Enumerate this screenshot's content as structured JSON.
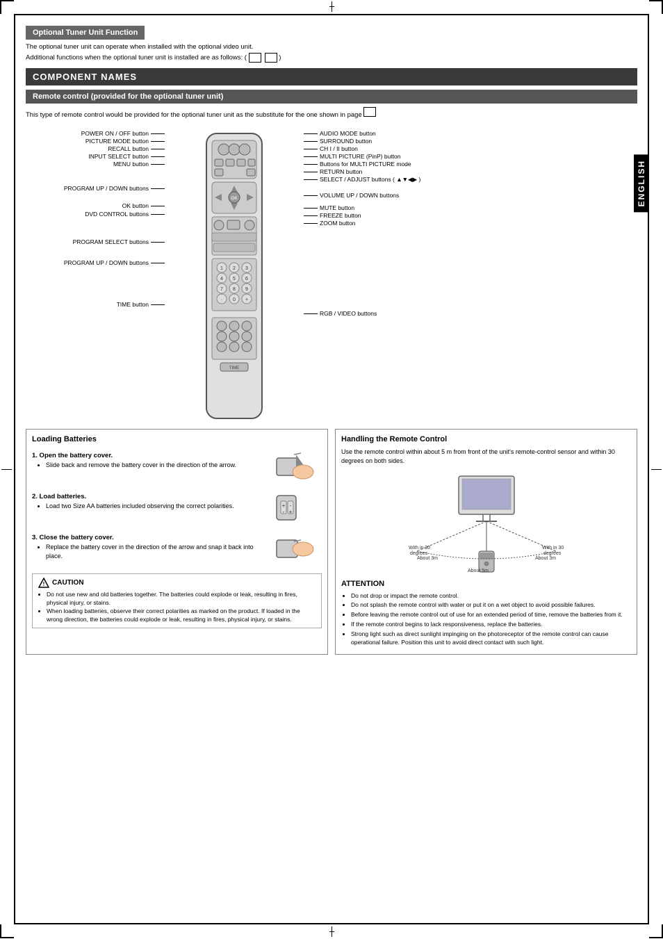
{
  "page": {
    "english_tab": "ENGLISH",
    "optional_header": "Optional Tuner Unit Function",
    "optional_desc1": "The optional tuner unit can operate when installed with the optional video unit.",
    "optional_desc2": "Additional functions when the optional tuner unit is installed are as follows: (",
    "component_names": "COMPONENT NAMES",
    "remote_section_title": "Remote control (provided for the optional tuner unit)",
    "remote_desc": "This type of remote control would be provided for the optional tuner unit as the substitute for the one shown in page",
    "left_labels": [
      "POWER ON / OFF button",
      "PICTURE MODE button",
      "RECALL button",
      "INPUT SELECT button",
      "MENU button",
      "PROGRAM UP / DOWN buttons",
      "OK button",
      "DVD CONTROL buttons",
      "PROGRAM SELECT buttons",
      "PROGRAM UP / DOWN buttons",
      "TIME button"
    ],
    "right_labels": [
      "AUDIO MODE button",
      "SURROUND button",
      "CH I / II button",
      "MULTI PICTURE (PinP) button",
      "Buttons for MULTI PICTURE mode",
      "RETURN button",
      "SELECT / ADJUST buttons ( ▲▼◀▶ )",
      "VOLUME UP / DOWN buttons",
      "MUTE button",
      "FREEZE button",
      "ZOOM button",
      "RGB / VIDEO buttons"
    ],
    "loading_batteries": {
      "title": "Loading Batteries",
      "step1_title": "1. Open the battery cover.",
      "step1_bullet": "Slide back and remove the battery cover in the direction of the arrow.",
      "step2_title": "2. Load batteries.",
      "step2_bullet": "Load two Size AA batteries included observing the correct polarities.",
      "step3_title": "3. Close the battery cover.",
      "step3_bullet": "Replace the battery cover in the direction of the arrow and snap it back into place."
    },
    "caution": {
      "title": "CAUTION",
      "bullets": [
        "Do not use new and old batteries together. The batteries could explode or leak, resulting in fires, physical injury, or stains.",
        "When loading batteries, observe their correct polarities as marked on the product. If loaded in the wrong direction, the batteries could explode or leak, resulting in fires, physical injury, or stains."
      ]
    },
    "handling": {
      "title": "Handling the Remote Control",
      "desc": "Use the remote control within about 5 m from front of the unit's remote-control sensor and within 30 degrees on both sides.",
      "diagram_labels": {
        "within30_left": "With in 30 degrees",
        "within30_right": "With in 30 degrees",
        "about3m_left": "About 3m",
        "about3m_right": "About 3m",
        "about5m": "About 5m"
      }
    },
    "attention": {
      "title": "ATTENTION",
      "bullets": [
        "Do not drop or impact the remote control.",
        "Do not splash the remote control with water or put it on a wet object to avoid possible failures.",
        "Before leaving the remote control out of use for an extended period of time, remove the batteries from it.",
        "If the remote control begins to lack responsiveness, replace the batteries.",
        "Strong light such as direct sunlight impinging on the photoreceptor of the remote control can cause operational failure. Position this unit to avoid direct contact with such light."
      ]
    }
  }
}
